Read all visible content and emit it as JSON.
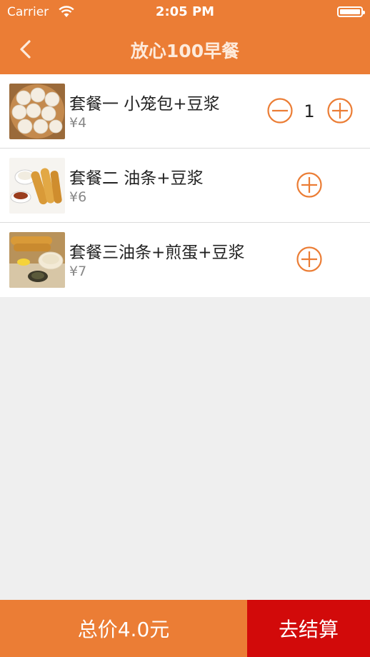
{
  "status_bar": {
    "carrier": "Carrier",
    "time": "2:05 PM"
  },
  "nav": {
    "title": "放心100早餐",
    "back_icon": "chevron-left-icon"
  },
  "items": [
    {
      "name": "套餐一 小笼包+豆浆",
      "price": "¥4",
      "quantity": "1",
      "image": "steamed-buns-photo"
    },
    {
      "name": "套餐二 油条+豆浆",
      "price": "¥6",
      "image": "fried-dough-soymilk-photo"
    },
    {
      "name": "套餐三油条+煎蛋+豆浆",
      "price": "¥7",
      "image": "fried-dough-egg-soymilk-photo"
    }
  ],
  "footer": {
    "total": "总价4.0元",
    "checkout": "去结算"
  },
  "colors": {
    "brand_orange": "#eb7d35",
    "checkout_red": "#d20a0a",
    "background": "#efefef"
  }
}
